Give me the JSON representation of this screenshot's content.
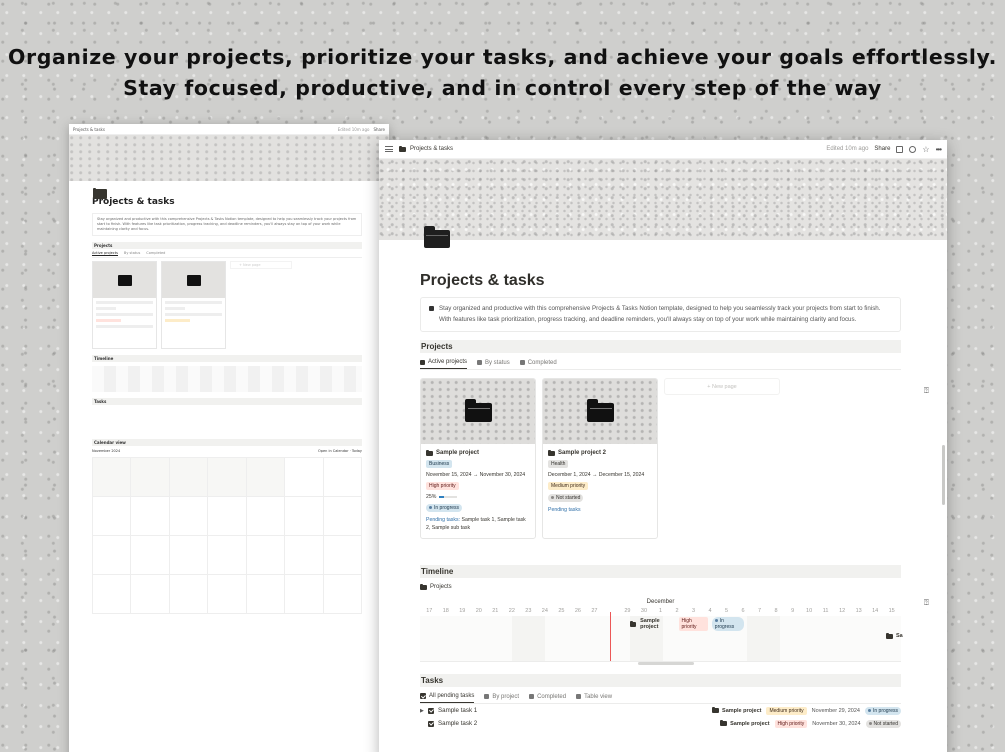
{
  "headline": {
    "line1": "Organize your projects, prioritize your tasks, and achieve your goals effortlessly.",
    "line2": "Stay focused, productive, and in control every step of the way"
  },
  "topbar": {
    "breadcrumb": "Projects & tasks",
    "edited": "Edited 10m ago",
    "share": "Share"
  },
  "page": {
    "title": "Projects & tasks",
    "description": "Stay organized and productive with this comprehensive Projects & Tasks Notion template, designed to help you seamlessly track your projects from start to finish. With features like task prioritization, progress tracking, and deadline reminders, you'll always stay on top of your work while maintaining clarity and focus."
  },
  "projects": {
    "heading": "Projects",
    "tabs": [
      "Active projects",
      "By status",
      "Completed"
    ],
    "new_page": "+ New page",
    "cards": [
      {
        "name": "Sample project",
        "tag": "Business",
        "dates": "November 15, 2024 → November 30, 2024",
        "priority": "High priority",
        "progress_label": "25%",
        "progress": 0.25,
        "status": "In progress",
        "pending_label": "Pending tasks:",
        "pending_items": "Sample task 1, Sample task 2, Sample sub task"
      },
      {
        "name": "Sample project 2",
        "tag": "Health",
        "dates": "December 1, 2024 → December 15, 2024",
        "priority": "Medium priority",
        "status": "Not started",
        "pending_label": "Pending tasks"
      }
    ]
  },
  "timeline": {
    "heading": "Timeline",
    "view": "Projects",
    "month": "December",
    "days": [
      "17",
      "18",
      "19",
      "20",
      "21",
      "22",
      "23",
      "24",
      "25",
      "26",
      "27",
      "28",
      "29",
      "30",
      "1",
      "2",
      "3",
      "4",
      "5",
      "6",
      "7",
      "8",
      "9",
      "10",
      "11",
      "12",
      "13",
      "14",
      "15"
    ],
    "today": "28",
    "bar": {
      "name": "Sample project",
      "priority": "High priority",
      "status": "In progress"
    },
    "bar2": "Sa"
  },
  "tasks": {
    "heading": "Tasks",
    "tabs": [
      "All pending tasks",
      "By project",
      "Completed",
      "Table view"
    ],
    "rows": [
      {
        "name": "Sample task 1",
        "project": "Sample project",
        "priority": "Medium priority",
        "date": "November 29, 2024",
        "status": "In progress"
      },
      {
        "name": "Sample task 2",
        "project": "Sample project",
        "priority": "High priority",
        "date": "November 30, 2024",
        "status": "Not started"
      }
    ]
  },
  "small_window": {
    "title": "Projects & tasks",
    "edited": "Edited 10m ago",
    "share": "Share",
    "sections": [
      "Projects",
      "Timeline",
      "Tasks",
      "Calendar view"
    ],
    "calendar_month": "November 2024",
    "open_in_calendar": "Open in Calendar",
    "today": "Today"
  }
}
